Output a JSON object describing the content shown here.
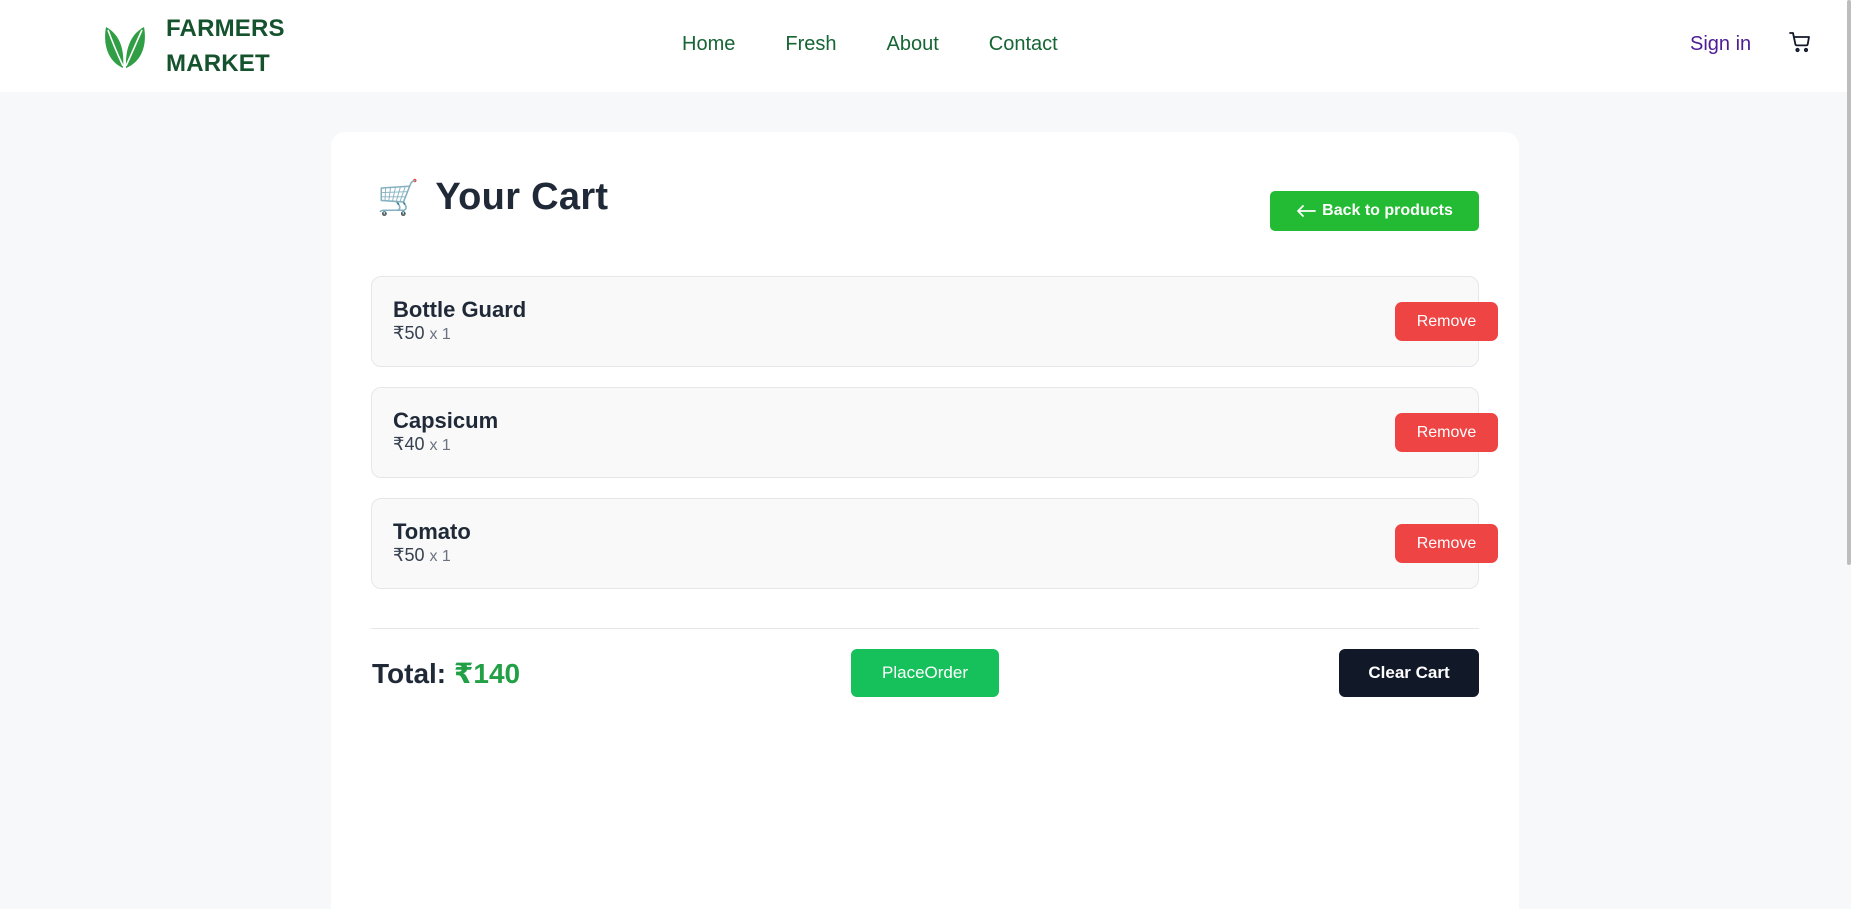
{
  "header": {
    "logo_line1": "FARMERS",
    "logo_line2": "MARKET",
    "nav": [
      "Home",
      "Fresh",
      "About",
      "Contact"
    ],
    "signin_label": "Sign in",
    "cart_icon": "shopping-cart-icon"
  },
  "cart": {
    "title_emoji": "🛒",
    "title": "Your Cart",
    "back_label": "Back to products",
    "items": [
      {
        "name": "Bottle Guard",
        "price": "₹50",
        "qty": "x 1",
        "remove_label": "Remove"
      },
      {
        "name": "Capsicum",
        "price": "₹40",
        "qty": "x 1",
        "remove_label": "Remove"
      },
      {
        "name": "Tomato",
        "price": "₹50",
        "qty": "x 1",
        "remove_label": "Remove"
      }
    ],
    "total_label": "Total:",
    "total_value": "₹140",
    "place_order_label": "PlaceOrder",
    "clear_label": "Clear Cart"
  },
  "colors": {
    "brand_green": "#14532d",
    "accent_green": "#22bb33",
    "remove_red": "#ef4444",
    "dark": "#111827"
  }
}
